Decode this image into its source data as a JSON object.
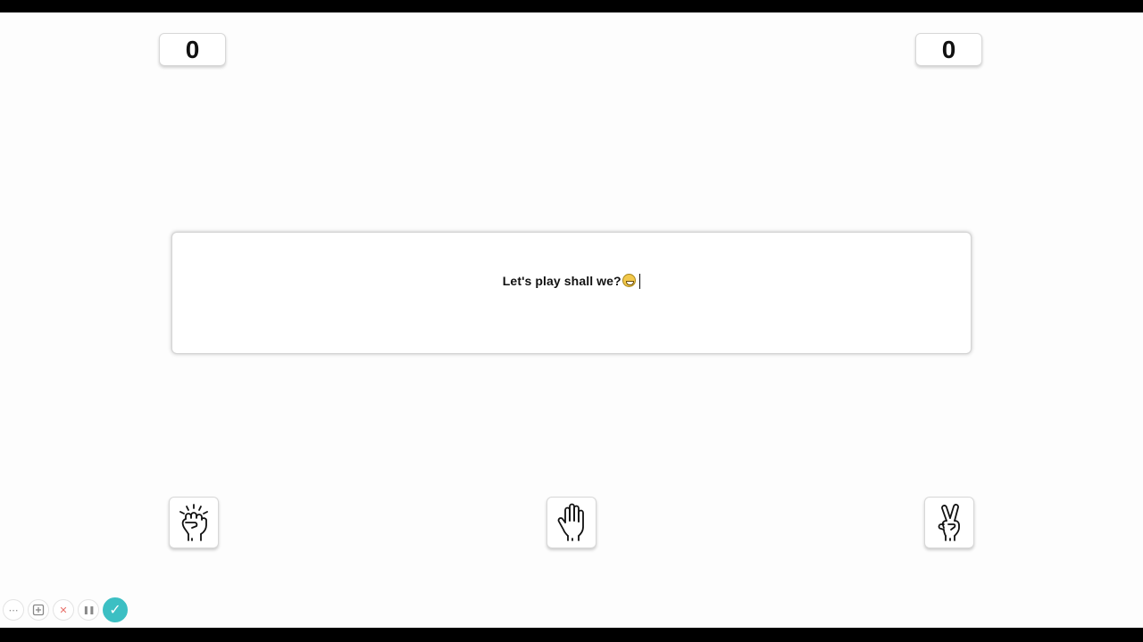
{
  "scores": {
    "player": "0",
    "computer": "0"
  },
  "message": {
    "text": "Let's play shall we?",
    "emoji": "grinning-face"
  },
  "choices": [
    {
      "name": "rock",
      "icon": "rock-fist-icon"
    },
    {
      "name": "paper",
      "icon": "paper-hand-icon"
    },
    {
      "name": "scissors",
      "icon": "scissors-hand-icon"
    }
  ],
  "toolbar": {
    "more": "⋯",
    "capture": "",
    "close": "✕",
    "pause": "❚❚",
    "confirm": "✓"
  },
  "colors": {
    "background": "#fdfdfd",
    "frame": "#000000",
    "accent": "#3cbfc3",
    "close": "#e8706a"
  }
}
